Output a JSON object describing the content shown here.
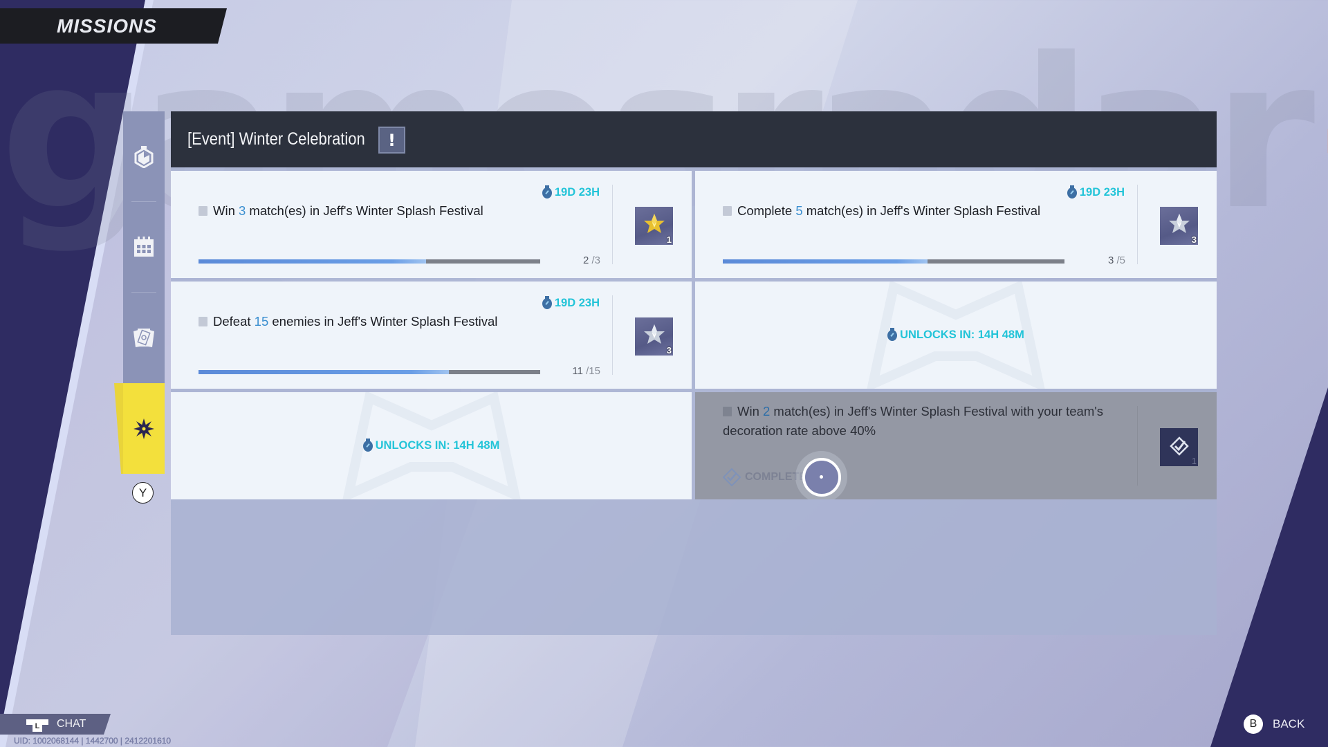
{
  "app": {
    "title": "MISSIONS",
    "watermark": "gamesradar",
    "watermark_plus": "+"
  },
  "sidebar": {
    "items": [
      {
        "name": "timed-missions",
        "icon": "stopwatch-hexagon-icon",
        "active": false
      },
      {
        "name": "daily-missions",
        "icon": "calendar-icon",
        "active": false
      },
      {
        "name": "card-missions",
        "icon": "cards-icon",
        "active": false
      },
      {
        "name": "event-missions",
        "icon": "snowflake-icon",
        "active": true
      }
    ],
    "switch_hint": "Y"
  },
  "header": {
    "title": "[Event] Winter Celebration",
    "info_label": "!"
  },
  "colors": {
    "accent_timer": "#23c4d8",
    "highlight_number": "#3b8fd0",
    "active_tab": "#f3e03c",
    "progress_fill": "#5b8ad8"
  },
  "missions": [
    {
      "pre": "Win ",
      "num": "3",
      "post": " match(es) in Jeff's Winter Splash Festival",
      "timer": "19D 23H",
      "progress": {
        "current": "2",
        "total": "/3",
        "fraction": 0.6667
      },
      "reward": {
        "type": "gold-star",
        "qty": "1"
      },
      "state": "in-progress"
    },
    {
      "pre": "Complete ",
      "num": "5",
      "post": " match(es) in Jeff's Winter Splash Festival",
      "timer": "19D 23H",
      "progress": {
        "current": "3",
        "total": "/5",
        "fraction": 0.6
      },
      "reward": {
        "type": "silver-star",
        "qty": "3"
      },
      "state": "in-progress"
    },
    {
      "pre": "Defeat ",
      "num": "15",
      "post": " enemies in Jeff's Winter Splash Festival",
      "timer": "19D 23H",
      "progress": {
        "current": "11",
        "total": "/15",
        "fraction": 0.7333
      },
      "reward": {
        "type": "silver-star",
        "qty": "3"
      },
      "state": "in-progress"
    },
    {
      "state": "locked",
      "unlock": "UNLOCKS IN: 14H 48M"
    },
    {
      "state": "locked",
      "unlock": "UNLOCKS IN: 14H 48M"
    },
    {
      "pre": "Win ",
      "num": "2",
      "post": " match(es) in Jeff's Winter Splash Festival with your team's decoration rate above 40%",
      "status": "COMPLETED",
      "reward": {
        "type": "checkmark-diamond",
        "qty": "1"
      },
      "state": "completed"
    }
  ],
  "footer": {
    "chat_label": "CHAT",
    "chat_button": "L",
    "uid": "UID: 1002068144 | 1442700 | 2412201610",
    "back_button": "B",
    "back_label": "BACK"
  }
}
